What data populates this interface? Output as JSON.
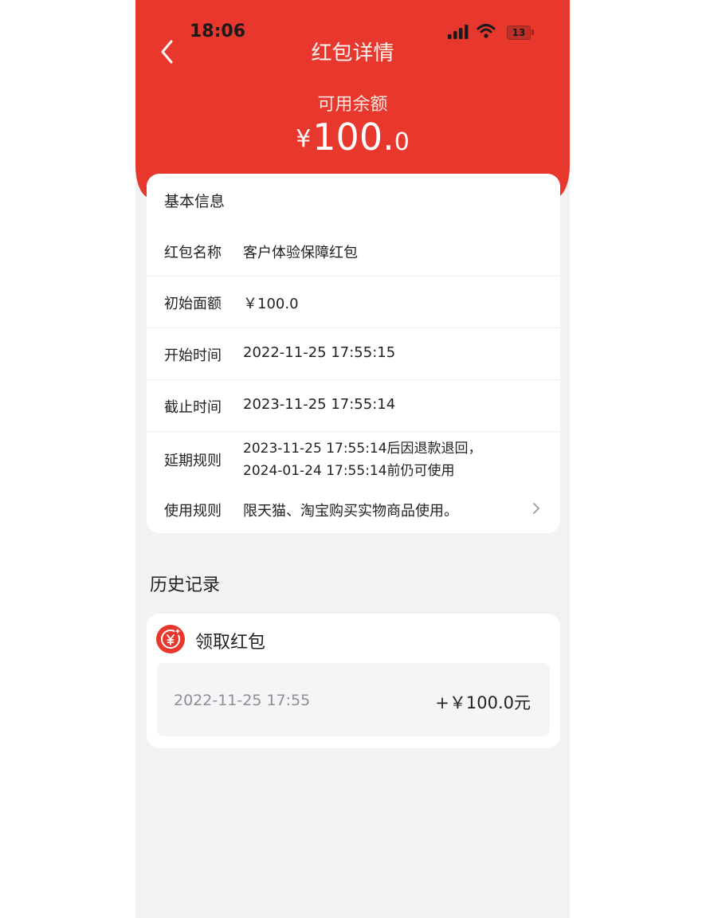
{
  "status_bar": {
    "time": "18:06",
    "battery": "13"
  },
  "header": {
    "title": "红包详情",
    "balance_label": "可用余额",
    "balance_currency": "¥",
    "balance_integer": "100.",
    "balance_decimal": "0"
  },
  "basic_info": {
    "title": "基本信息",
    "rows": [
      {
        "label": "红包名称",
        "value": "客户体验保障红包"
      },
      {
        "label": "初始面额",
        "value": "￥100.0"
      },
      {
        "label": "开始时间",
        "value": "2022-11-25 17:55:15"
      },
      {
        "label": "截止时间",
        "value": "2023-11-25 17:55:14"
      },
      {
        "label": "延期规则",
        "value_line1": "2023-11-25 17:55:14后因退款退回，",
        "value_line2": "2024-01-24 17:55:14前仍可使用"
      },
      {
        "label": "使用规则",
        "value": "限天猫、淘宝购买实物商品使用。"
      }
    ]
  },
  "history": {
    "title": "历史记录",
    "record_type": "领取红包",
    "records": [
      {
        "time": "2022-11-25 17:55",
        "amount": "+￥100.0元"
      }
    ]
  },
  "colors": {
    "brand_red": "#e8382e",
    "background": "#f2f2f4"
  },
  "icons": [
    "back-arrow-icon",
    "signal-icon",
    "wifi-icon",
    "battery-icon",
    "chevron-right-icon",
    "red-packet-coin-icon"
  ]
}
